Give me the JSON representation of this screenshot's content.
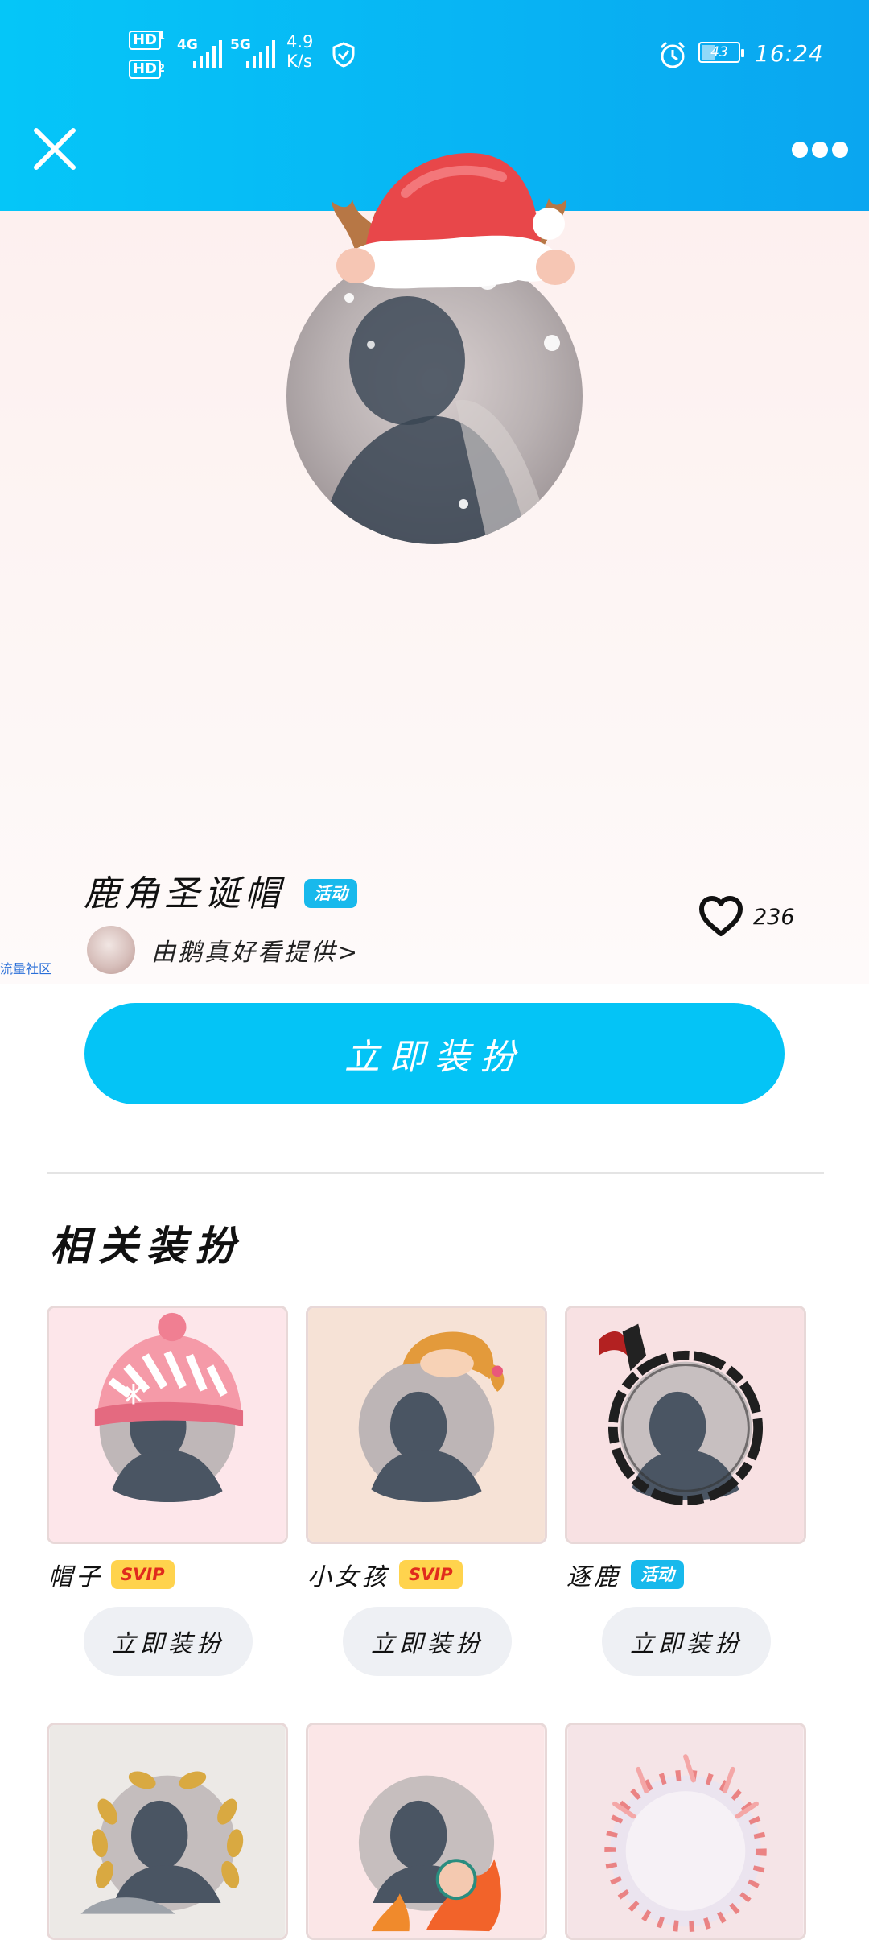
{
  "status_bar": {
    "sim1": "HD",
    "sim1_sub": "1",
    "sim2": "HD",
    "sim2_sub": "2",
    "net1": "4G",
    "net2": "5G",
    "speed_value": "4.9",
    "speed_unit": "K/s",
    "battery": "43",
    "time": "16:24"
  },
  "toolbar": {
    "close_icon": "close-icon",
    "more_icon": "more-icon"
  },
  "item": {
    "title": "鹿角圣诞帽",
    "badge": "活动",
    "provider": "由鹅真好看提供",
    "provider_arrow": ">",
    "likes": "236",
    "side_tag": "流量社区",
    "cta": "立即装扮"
  },
  "related": {
    "title": "相关装扮",
    "items": [
      {
        "name": "帽子",
        "badge": "SVIP",
        "badge_type": "svip",
        "button": "立即装扮",
        "bg": "#fde6ea"
      },
      {
        "name": "小女孩",
        "badge": "SVIP",
        "badge_type": "svip",
        "button": "立即装扮",
        "bg": "#f6e2d6"
      },
      {
        "name": "逐鹿",
        "badge": "活动",
        "badge_type": "activity",
        "button": "立即装扮",
        "bg": "#f8e1e3"
      },
      {
        "name": "",
        "badge": "",
        "badge_type": "",
        "button": "",
        "bg": "#ece9e6"
      },
      {
        "name": "",
        "badge": "",
        "badge_type": "",
        "button": "",
        "bg": "#fbe6e7"
      },
      {
        "name": "",
        "badge": "",
        "badge_type": "",
        "button": "",
        "bg": "#f5e4e7"
      }
    ]
  },
  "colors": {
    "header_blue": "#05c6f8",
    "cta_blue": "#04c4f6",
    "activity_badge": "#18b9ec",
    "svip_badge": "#ffd34d",
    "svip_text": "#e02b1d"
  }
}
